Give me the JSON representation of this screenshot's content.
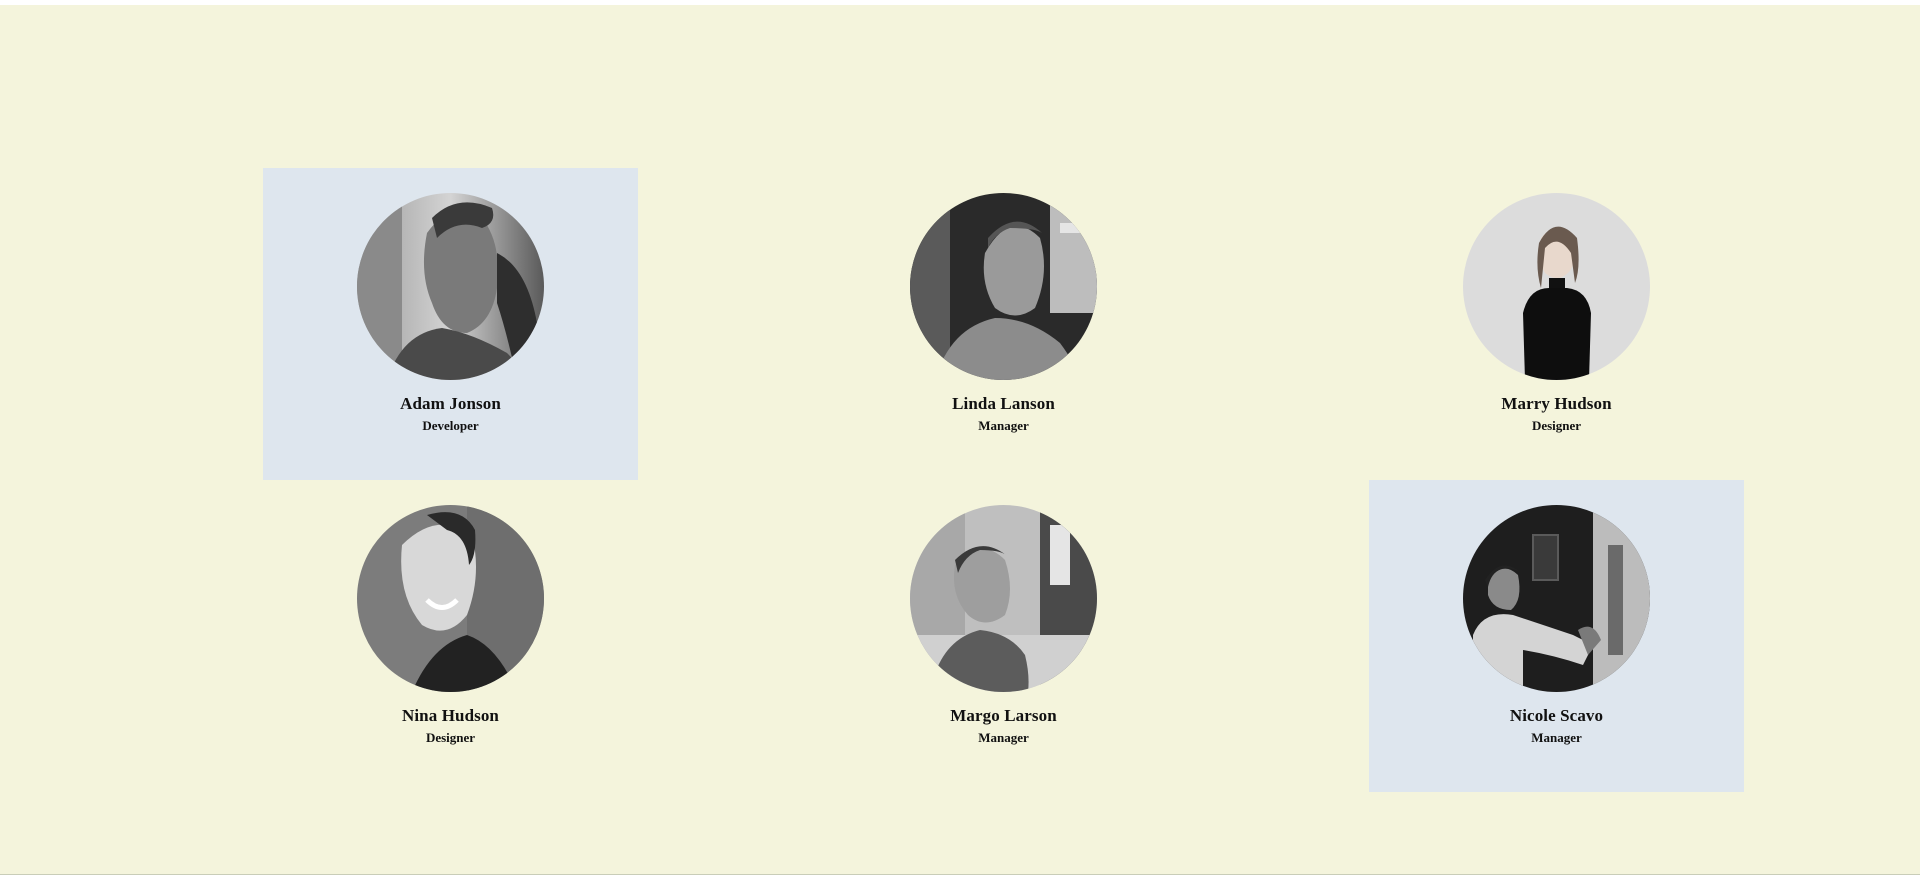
{
  "colors": {
    "page_background": "#f4f4dc",
    "highlight_card": "#dee6ee",
    "text": "#111111"
  },
  "team": [
    {
      "name": "Adam Jonson",
      "role": "Developer",
      "highlighted": true,
      "avatar_icon": "portrait-man-photo"
    },
    {
      "name": "Linda Lanson",
      "role": "Manager",
      "highlighted": false,
      "avatar_icon": "portrait-man-photo"
    },
    {
      "name": "Marry Hudson",
      "role": "Designer",
      "highlighted": false,
      "avatar_icon": "portrait-woman-photo"
    },
    {
      "name": "Nina Hudson",
      "role": "Designer",
      "highlighted": false,
      "avatar_icon": "portrait-man-smiling-photo"
    },
    {
      "name": "Margo Larson",
      "role": "Manager",
      "highlighted": false,
      "avatar_icon": "portrait-man-profile-photo"
    },
    {
      "name": "Nicole Scavo",
      "role": "Manager",
      "highlighted": true,
      "avatar_icon": "portrait-man-window-photo"
    }
  ]
}
